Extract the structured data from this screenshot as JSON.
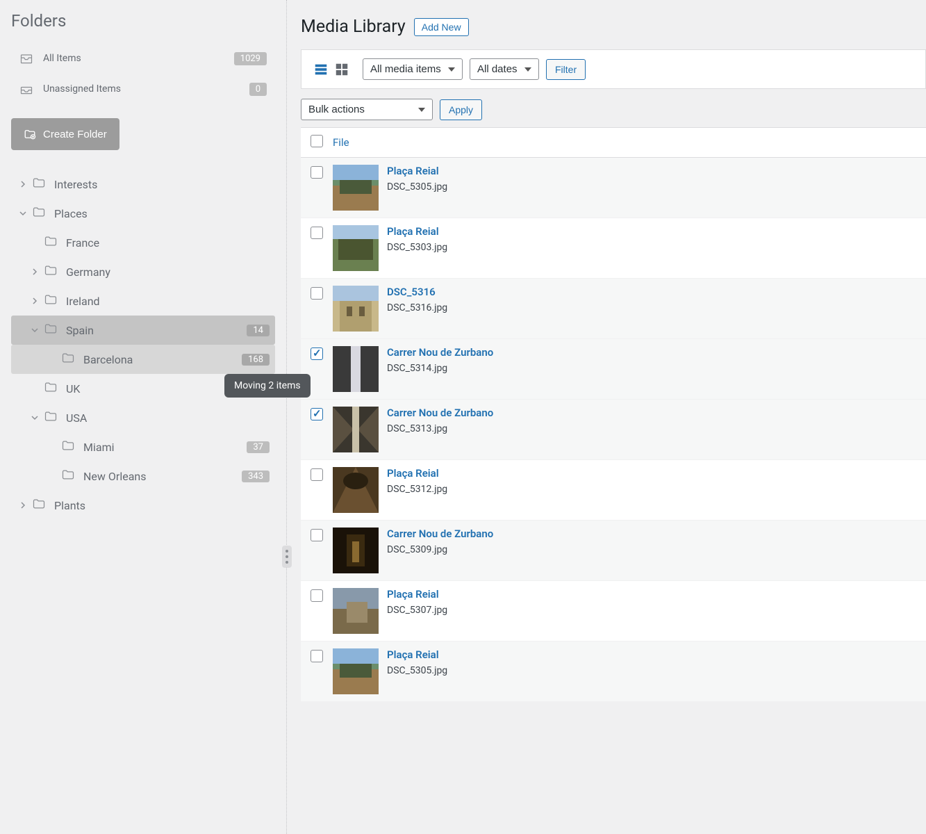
{
  "sidebar": {
    "title": "Folders",
    "allItems": {
      "label": "All Items",
      "count": "1029"
    },
    "unassigned": {
      "label": "Unassigned Items",
      "count": "0"
    },
    "createFolder": "Create Folder",
    "dragTooltip": "Moving 2 items",
    "tree": [
      {
        "label": "Interests",
        "indent": 0,
        "chev": "right"
      },
      {
        "label": "Places",
        "indent": 0,
        "chev": "down"
      },
      {
        "label": "France",
        "indent": 1,
        "chev": ""
      },
      {
        "label": "Germany",
        "indent": 1,
        "chev": "right"
      },
      {
        "label": "Ireland",
        "indent": 1,
        "chev": "right"
      },
      {
        "label": "Spain",
        "indent": 1,
        "chev": "down",
        "count": "14",
        "sel": true
      },
      {
        "label": "Barcelona",
        "indent": 2,
        "chev": "",
        "count": "168",
        "hover": true
      },
      {
        "label": "UK",
        "indent": 1,
        "chev": ""
      },
      {
        "label": "USA",
        "indent": 1,
        "chev": "down"
      },
      {
        "label": "Miami",
        "indent": 2,
        "chev": "",
        "count": "37"
      },
      {
        "label": "New Orleans",
        "indent": 2,
        "chev": "",
        "count": "343"
      },
      {
        "label": "Plants",
        "indent": 0,
        "chev": "right"
      }
    ]
  },
  "main": {
    "title": "Media Library",
    "addNew": "Add New",
    "mediaFilter": "All media items",
    "dateFilter": "All dates",
    "filterBtn": "Filter",
    "bulkActions": "Bulk actions",
    "applyBtn": "Apply",
    "fileColumn": "File",
    "rows": [
      {
        "title": "Plaça Reial",
        "filename": "DSC_5305.jpg",
        "checked": false,
        "thumb": "plaza"
      },
      {
        "title": "Plaça Reial",
        "filename": "DSC_5303.jpg",
        "checked": false,
        "thumb": "plaza2"
      },
      {
        "title": "DSC_5316",
        "filename": "DSC_5316.jpg",
        "checked": false,
        "thumb": "building"
      },
      {
        "title": "Carrer Nou de Zurbano",
        "filename": "DSC_5314.jpg",
        "checked": true,
        "thumb": "street"
      },
      {
        "title": "Carrer Nou de Zurbano",
        "filename": "DSC_5313.jpg",
        "checked": true,
        "thumb": "street2"
      },
      {
        "title": "Plaça Reial",
        "filename": "DSC_5312.jpg",
        "checked": false,
        "thumb": "arcade"
      },
      {
        "title": "Carrer Nou de Zurbano",
        "filename": "DSC_5309.jpg",
        "checked": false,
        "thumb": "dark"
      },
      {
        "title": "Plaça Reial",
        "filename": "DSC_5307.jpg",
        "checked": false,
        "thumb": "corner"
      },
      {
        "title": "Plaça Reial",
        "filename": "DSC_5305.jpg",
        "checked": false,
        "thumb": "plaza"
      }
    ]
  }
}
